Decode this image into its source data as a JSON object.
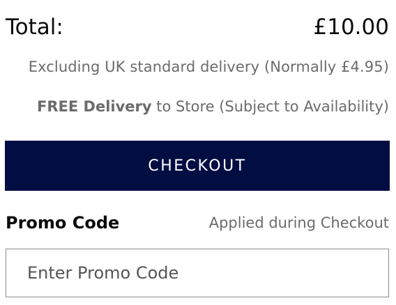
{
  "summary": {
    "total_label": "Total:",
    "total_value": "£10.00",
    "excluding_delivery": "Excluding UK standard delivery (Normally £4.95)",
    "free_delivery_strong": "FREE Delivery",
    "free_delivery_rest": " to Store (Subject to Availability)"
  },
  "checkout": {
    "button_label": "CHECKOUT"
  },
  "promo": {
    "label": "Promo Code",
    "note": "Applied during Checkout",
    "placeholder": "Enter Promo Code",
    "value": ""
  },
  "colors": {
    "checkout_background": "#020d42",
    "checkout_text": "#ffffff",
    "secondary_text": "#6b6b6b",
    "primary_text": "#0b0b0b",
    "input_border": "#8c8c8c"
  }
}
